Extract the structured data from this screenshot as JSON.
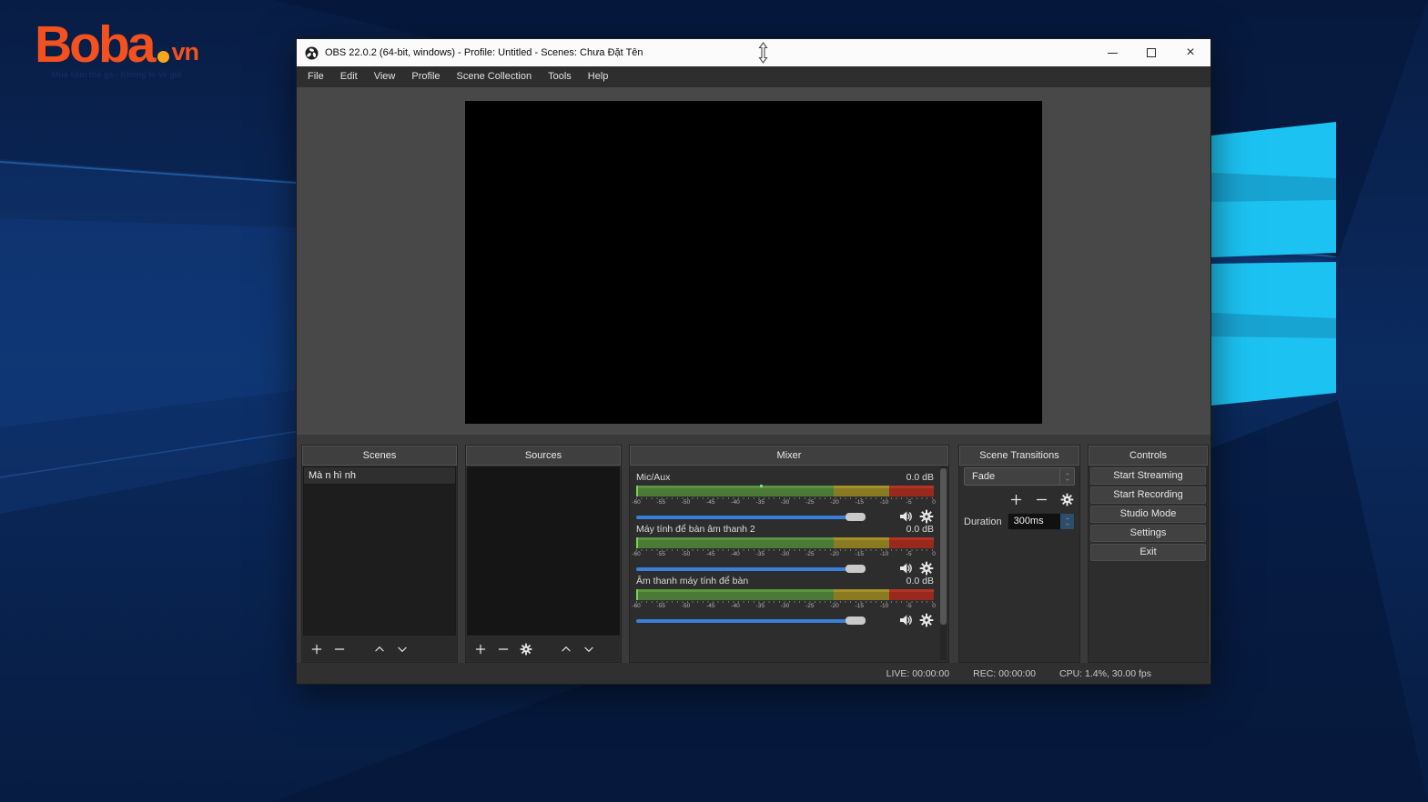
{
  "desktop": {
    "logo": {
      "brand": "Boba",
      "tld": "vn",
      "tagline": "Mua sắm thả ga - Không lo về giá"
    },
    "wallpaper_colors": {
      "base_navy": "#0a2351",
      "beam_blue": "#1a4d94",
      "pane_cyan": "#1cc3f2",
      "pane_band": "#189fcc"
    }
  },
  "window": {
    "title": "OBS 22.0.2 (64-bit, windows) - Profile: Untitled - Scenes: Chưa Đặt Tên",
    "menu": [
      "File",
      "Edit",
      "View",
      "Profile",
      "Scene Collection",
      "Tools",
      "Help"
    ],
    "controls": [
      "minimize",
      "maximize",
      "close"
    ],
    "close_glyph": "×"
  },
  "panels": {
    "scenes": {
      "title": "Scenes",
      "items": [
        "Mà n hì nh"
      ]
    },
    "sources": {
      "title": "Sources",
      "items": []
    },
    "mixer": {
      "title": "Mixer",
      "ticks": [
        "-60",
        "-55",
        "-50",
        "-45",
        "-40",
        "-35",
        "-30",
        "-25",
        "-20",
        "-15",
        "-10",
        "-5",
        "0"
      ],
      "channels": [
        {
          "name": "Mic/Aux",
          "level_label": "0.0 dB",
          "volume_pct": 93,
          "peak_marker_db": -35
        },
        {
          "name": "Máy tính để bàn âm thanh 2",
          "level_label": "0.0 dB",
          "volume_pct": 93,
          "peak_marker_db": null
        },
        {
          "name": "Âm thanh máy tính để bàn",
          "level_label": "0.0 dB",
          "volume_pct": 93,
          "peak_marker_db": null
        }
      ]
    },
    "transitions": {
      "title": "Scene Transitions",
      "selected_transition": "Fade",
      "duration_label": "Duration",
      "duration_value": "300ms"
    },
    "controls": {
      "title": "Controls",
      "buttons": [
        "Start Streaming",
        "Start Recording",
        "Studio Mode",
        "Settings",
        "Exit"
      ]
    }
  },
  "statusbar": {
    "live": "LIVE: 00:00:00",
    "rec": "REC: 00:00:00",
    "cpu": "CPU: 1.4%, 30.00 fps"
  }
}
